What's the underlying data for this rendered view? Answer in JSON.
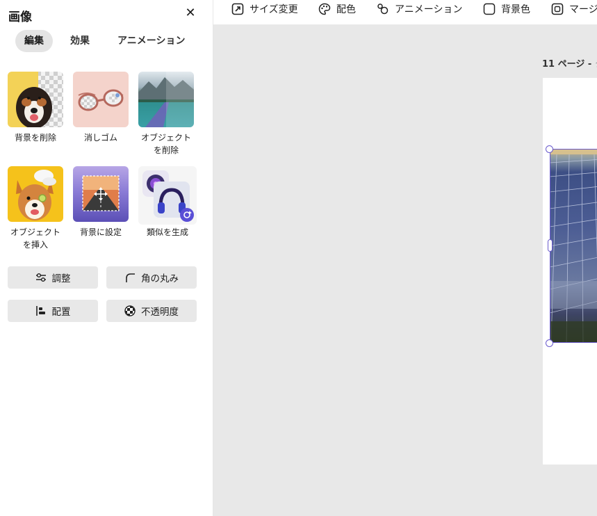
{
  "panel": {
    "title": "画像",
    "close": "✕",
    "tabs": [
      {
        "label": "編集",
        "active": true
      },
      {
        "label": "効果",
        "active": false
      },
      {
        "label": "アニメーション",
        "active": false
      }
    ],
    "tools": [
      {
        "label": "背景を削除",
        "icon": "remove-background-icon"
      },
      {
        "label": "消しゴム",
        "icon": "eraser-icon"
      },
      {
        "label": "オブジェクト\nを削除",
        "icon": "remove-object-icon"
      },
      {
        "label": "オブジェクト\nを挿入",
        "icon": "insert-object-icon"
      },
      {
        "label": "背景に設定",
        "icon": "set-as-background-icon"
      },
      {
        "label": "類似を生成",
        "icon": "generate-similar-icon"
      }
    ],
    "buttons": {
      "adjust": "調整",
      "corner": "角の丸み",
      "align": "配置",
      "opacity": "不透明度"
    }
  },
  "toolbar": {
    "resize": "サイズ変更",
    "colors": "配色",
    "animation": "アニメーション",
    "background": "背景色",
    "margin": "マージ"
  },
  "canvas": {
    "page_number": "11 ページ -",
    "page_title": "タ"
  },
  "colors": {
    "accent": "#6a5acd",
    "button_bg": "#e8e8e8",
    "canvas_bg": "#e8e8e8"
  }
}
